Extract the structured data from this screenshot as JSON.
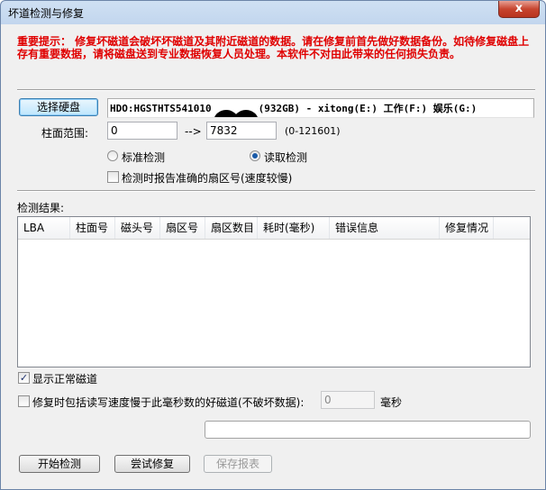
{
  "window": {
    "title": "坏道检测与修复",
    "close_glyph": "x"
  },
  "warning": {
    "text": "重要提示：  修复坏磁道会破坏坏磁道及其附近磁道的数据。请在修复前首先做好数据备份。如待修复磁盘上存有重要数据，请将磁盘送到专业数据恢复人员处理。本软件不对由此带来的任何损失负责。"
  },
  "disk": {
    "select_label": "选择硬盘",
    "info_left": "HDO:HGSTHTS541010",
    "info_right": "(932GB) - xitong(E:) 工作(F:) 娱乐(G:)"
  },
  "cylinder": {
    "label": "柱面范围:",
    "from": "0",
    "arrow": "-->",
    "to": "7832",
    "range_hint": "(0-121601)"
  },
  "mode": {
    "standard_label": "标准检测",
    "read_label": "读取检测",
    "selected": "read"
  },
  "report_option": {
    "label": "检测时报告准确的扇区号(速度较慢)",
    "checked": false
  },
  "results": {
    "label": "检测结果:",
    "columns": [
      "LBA",
      "柱面号",
      "磁头号",
      "扇区号",
      "扇区数目",
      "耗时(毫秒)",
      "错误信息",
      "修复情况"
    ]
  },
  "show_normal": {
    "label": "显示正常磁道",
    "checked": true
  },
  "repair_slow": {
    "label": "修复时包括读写速度慢于此毫秒数的好磁道(不破坏数据):",
    "value": "0",
    "unit": "毫秒",
    "checked": false
  },
  "progress": {
    "value": 0
  },
  "buttons": {
    "start": "开始检测",
    "try_repair": "尝试修复",
    "save_report": "保存报表"
  }
}
